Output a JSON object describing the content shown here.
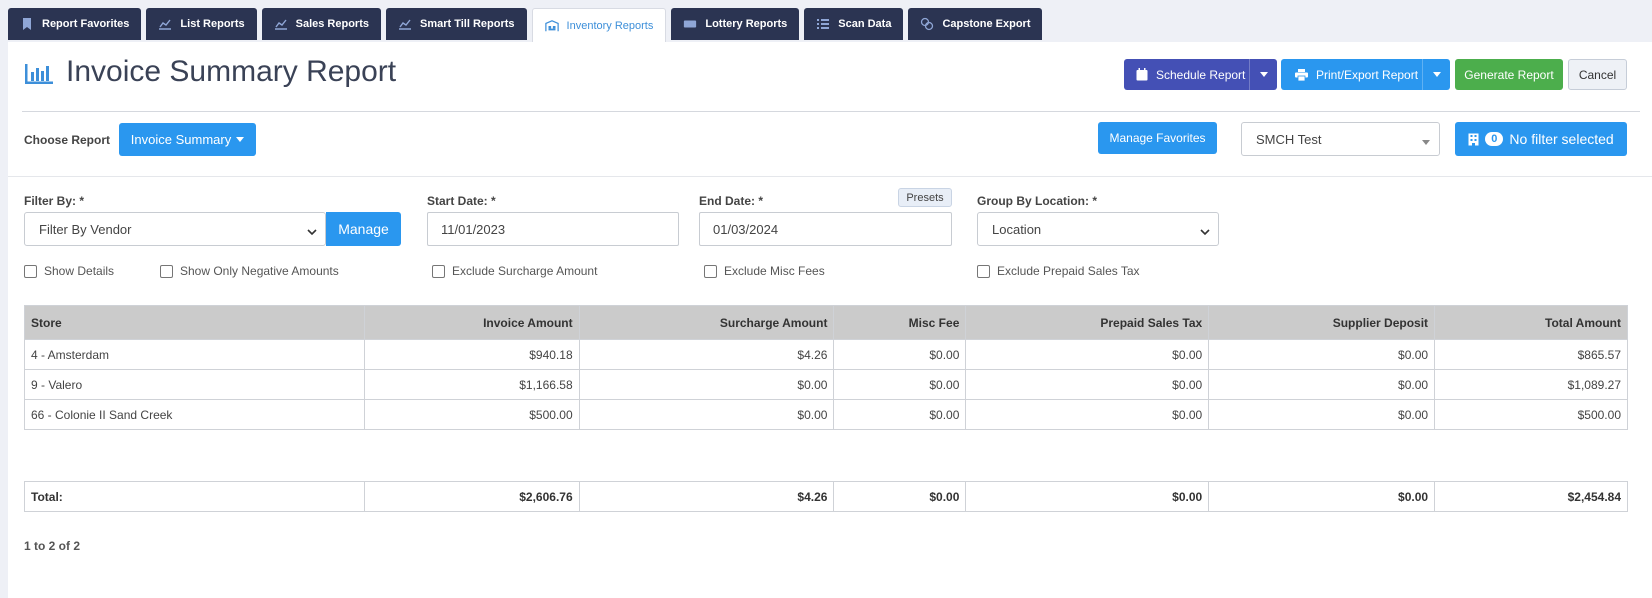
{
  "tabs": [
    {
      "label": "Report Favorites",
      "icon": "bookmark-icon"
    },
    {
      "label": "List Reports",
      "icon": "line-chart-icon"
    },
    {
      "label": "Sales Reports",
      "icon": "line-chart-icon"
    },
    {
      "label": "Smart Till Reports",
      "icon": "line-chart-icon"
    },
    {
      "label": "Inventory Reports",
      "icon": "warehouse-icon",
      "active": true
    },
    {
      "label": "Lottery Reports",
      "icon": "ticket-icon"
    },
    {
      "label": "Scan Data",
      "icon": "list-icon"
    },
    {
      "label": "Capstone Export",
      "icon": "coins-icon"
    }
  ],
  "header": {
    "title": "Invoice Summary Report",
    "schedule_label": "Schedule Report",
    "print_label": "Print/Export Report",
    "generate_label": "Generate Report",
    "cancel_label": "Cancel"
  },
  "choose": {
    "label": "Choose Report",
    "selected": "Invoice Summary",
    "manage_favorites": "Manage Favorites",
    "store_group": "SMCH Test",
    "filter_count": "0",
    "filter_label": "No filter selected"
  },
  "filters": {
    "filter_by_label": "Filter By: *",
    "filter_by_value": "Filter By Vendor",
    "manage_label": "Manage",
    "start_label": "Start Date: *",
    "start_value": "11/01/2023",
    "end_label": "End Date: *",
    "end_value": "01/03/2024",
    "presets_label": "Presets",
    "group_label": "Group By Location: *",
    "group_value": "Location"
  },
  "checkboxes": {
    "show_details": "Show Details",
    "show_negative": "Show Only Negative Amounts",
    "exclude_surcharge": "Exclude Surcharge Amount",
    "exclude_misc": "Exclude Misc Fees",
    "exclude_prepaid": "Exclude Prepaid Sales Tax"
  },
  "table": {
    "headers": [
      "Store",
      "Invoice Amount",
      "Surcharge Amount",
      "Misc Fee",
      "Prepaid Sales Tax",
      "Supplier Deposit",
      "Total Amount"
    ],
    "rows": [
      [
        "4 - Amsterdam",
        "$940.18",
        "$4.26",
        "$0.00",
        "$0.00",
        "$0.00",
        "$865.57"
      ],
      [
        "9 - Valero",
        "$1,166.58",
        "$0.00",
        "$0.00",
        "$0.00",
        "$0.00",
        "$1,089.27"
      ],
      [
        "66 - Colonie II Sand Creek",
        "$500.00",
        "$0.00",
        "$0.00",
        "$0.00",
        "$0.00",
        "$500.00"
      ]
    ],
    "totals": [
      "Total:",
      "$2,606.76",
      "$4.26",
      "$0.00",
      "$0.00",
      "$0.00",
      "$2,454.84"
    ]
  },
  "pager": "1 to 2 of 2",
  "colors": {
    "tab_bg": "#2b3452",
    "indigo": "#4450b5",
    "blue": "#2a97ef",
    "green": "#4cae4c"
  }
}
